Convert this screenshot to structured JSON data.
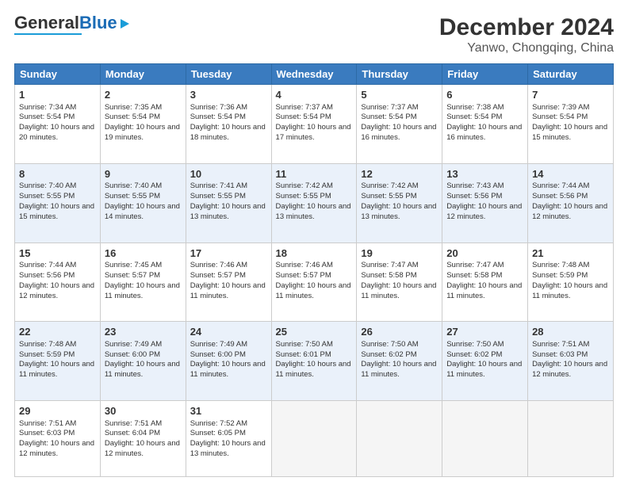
{
  "logo": {
    "line1": "General",
    "line2": "Blue"
  },
  "header": {
    "title": "December 2024",
    "subtitle": "Yanwo, Chongqing, China"
  },
  "weekdays": [
    "Sunday",
    "Monday",
    "Tuesday",
    "Wednesday",
    "Thursday",
    "Friday",
    "Saturday"
  ],
  "weeks": [
    [
      {
        "day": "1",
        "sunrise": "Sunrise: 7:34 AM",
        "sunset": "Sunset: 5:54 PM",
        "daylight": "Daylight: 10 hours and 20 minutes."
      },
      {
        "day": "2",
        "sunrise": "Sunrise: 7:35 AM",
        "sunset": "Sunset: 5:54 PM",
        "daylight": "Daylight: 10 hours and 19 minutes."
      },
      {
        "day": "3",
        "sunrise": "Sunrise: 7:36 AM",
        "sunset": "Sunset: 5:54 PM",
        "daylight": "Daylight: 10 hours and 18 minutes."
      },
      {
        "day": "4",
        "sunrise": "Sunrise: 7:37 AM",
        "sunset": "Sunset: 5:54 PM",
        "daylight": "Daylight: 10 hours and 17 minutes."
      },
      {
        "day": "5",
        "sunrise": "Sunrise: 7:37 AM",
        "sunset": "Sunset: 5:54 PM",
        "daylight": "Daylight: 10 hours and 16 minutes."
      },
      {
        "day": "6",
        "sunrise": "Sunrise: 7:38 AM",
        "sunset": "Sunset: 5:54 PM",
        "daylight": "Daylight: 10 hours and 16 minutes."
      },
      {
        "day": "7",
        "sunrise": "Sunrise: 7:39 AM",
        "sunset": "Sunset: 5:54 PM",
        "daylight": "Daylight: 10 hours and 15 minutes."
      }
    ],
    [
      {
        "day": "8",
        "sunrise": "Sunrise: 7:40 AM",
        "sunset": "Sunset: 5:55 PM",
        "daylight": "Daylight: 10 hours and 15 minutes."
      },
      {
        "day": "9",
        "sunrise": "Sunrise: 7:40 AM",
        "sunset": "Sunset: 5:55 PM",
        "daylight": "Daylight: 10 hours and 14 minutes."
      },
      {
        "day": "10",
        "sunrise": "Sunrise: 7:41 AM",
        "sunset": "Sunset: 5:55 PM",
        "daylight": "Daylight: 10 hours and 13 minutes."
      },
      {
        "day": "11",
        "sunrise": "Sunrise: 7:42 AM",
        "sunset": "Sunset: 5:55 PM",
        "daylight": "Daylight: 10 hours and 13 minutes."
      },
      {
        "day": "12",
        "sunrise": "Sunrise: 7:42 AM",
        "sunset": "Sunset: 5:55 PM",
        "daylight": "Daylight: 10 hours and 13 minutes."
      },
      {
        "day": "13",
        "sunrise": "Sunrise: 7:43 AM",
        "sunset": "Sunset: 5:56 PM",
        "daylight": "Daylight: 10 hours and 12 minutes."
      },
      {
        "day": "14",
        "sunrise": "Sunrise: 7:44 AM",
        "sunset": "Sunset: 5:56 PM",
        "daylight": "Daylight: 10 hours and 12 minutes."
      }
    ],
    [
      {
        "day": "15",
        "sunrise": "Sunrise: 7:44 AM",
        "sunset": "Sunset: 5:56 PM",
        "daylight": "Daylight: 10 hours and 12 minutes."
      },
      {
        "day": "16",
        "sunrise": "Sunrise: 7:45 AM",
        "sunset": "Sunset: 5:57 PM",
        "daylight": "Daylight: 10 hours and 11 minutes."
      },
      {
        "day": "17",
        "sunrise": "Sunrise: 7:46 AM",
        "sunset": "Sunset: 5:57 PM",
        "daylight": "Daylight: 10 hours and 11 minutes."
      },
      {
        "day": "18",
        "sunrise": "Sunrise: 7:46 AM",
        "sunset": "Sunset: 5:57 PM",
        "daylight": "Daylight: 10 hours and 11 minutes."
      },
      {
        "day": "19",
        "sunrise": "Sunrise: 7:47 AM",
        "sunset": "Sunset: 5:58 PM",
        "daylight": "Daylight: 10 hours and 11 minutes."
      },
      {
        "day": "20",
        "sunrise": "Sunrise: 7:47 AM",
        "sunset": "Sunset: 5:58 PM",
        "daylight": "Daylight: 10 hours and 11 minutes."
      },
      {
        "day": "21",
        "sunrise": "Sunrise: 7:48 AM",
        "sunset": "Sunset: 5:59 PM",
        "daylight": "Daylight: 10 hours and 11 minutes."
      }
    ],
    [
      {
        "day": "22",
        "sunrise": "Sunrise: 7:48 AM",
        "sunset": "Sunset: 5:59 PM",
        "daylight": "Daylight: 10 hours and 11 minutes."
      },
      {
        "day": "23",
        "sunrise": "Sunrise: 7:49 AM",
        "sunset": "Sunset: 6:00 PM",
        "daylight": "Daylight: 10 hours and 11 minutes."
      },
      {
        "day": "24",
        "sunrise": "Sunrise: 7:49 AM",
        "sunset": "Sunset: 6:00 PM",
        "daylight": "Daylight: 10 hours and 11 minutes."
      },
      {
        "day": "25",
        "sunrise": "Sunrise: 7:50 AM",
        "sunset": "Sunset: 6:01 PM",
        "daylight": "Daylight: 10 hours and 11 minutes."
      },
      {
        "day": "26",
        "sunrise": "Sunrise: 7:50 AM",
        "sunset": "Sunset: 6:02 PM",
        "daylight": "Daylight: 10 hours and 11 minutes."
      },
      {
        "day": "27",
        "sunrise": "Sunrise: 7:50 AM",
        "sunset": "Sunset: 6:02 PM",
        "daylight": "Daylight: 10 hours and 11 minutes."
      },
      {
        "day": "28",
        "sunrise": "Sunrise: 7:51 AM",
        "sunset": "Sunset: 6:03 PM",
        "daylight": "Daylight: 10 hours and 12 minutes."
      }
    ],
    [
      {
        "day": "29",
        "sunrise": "Sunrise: 7:51 AM",
        "sunset": "Sunset: 6:03 PM",
        "daylight": "Daylight: 10 hours and 12 minutes."
      },
      {
        "day": "30",
        "sunrise": "Sunrise: 7:51 AM",
        "sunset": "Sunset: 6:04 PM",
        "daylight": "Daylight: 10 hours and 12 minutes."
      },
      {
        "day": "31",
        "sunrise": "Sunrise: 7:52 AM",
        "sunset": "Sunset: 6:05 PM",
        "daylight": "Daylight: 10 hours and 13 minutes."
      },
      null,
      null,
      null,
      null
    ]
  ]
}
